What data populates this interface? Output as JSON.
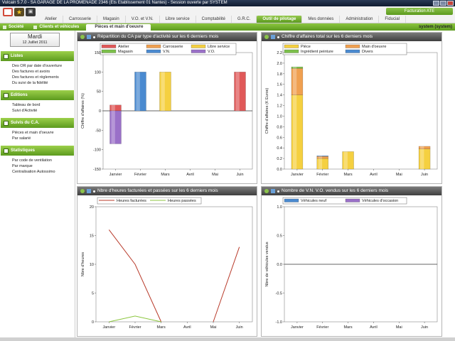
{
  "window": {
    "title": "Vulcain 5.7.0 - SA GARAGE DE LA PROMENADE 2346 (Ets Etablissement 01 Nantes) - Session ouverte par SYSTEM"
  },
  "toolbar": {
    "facturation_label": "Facturation ATE"
  },
  "menu": {
    "tabs": [
      {
        "label": "Atelier",
        "active": false
      },
      {
        "label": "Carrosserie",
        "active": false
      },
      {
        "label": "Magasin",
        "active": false
      },
      {
        "label": "V.O. et V.N.",
        "active": false
      },
      {
        "label": "Libre service",
        "active": false
      },
      {
        "label": "Comptabilité",
        "active": false
      },
      {
        "label": "G.R.C.",
        "active": false
      },
      {
        "label": "Outil de pilotage",
        "active": true
      },
      {
        "label": "Mes données",
        "active": false
      },
      {
        "label": "Administration",
        "active": false
      },
      {
        "label": "Fiducial",
        "active": false
      }
    ]
  },
  "submenu": {
    "items": [
      {
        "label": "Société",
        "selected": false
      },
      {
        "label": "Clients et véhicules",
        "selected": false
      },
      {
        "label": "Pièces et main d'oeuvre",
        "selected": true
      }
    ],
    "user": "system (system)"
  },
  "sidebar": {
    "day": "Mardi",
    "date": "12 Juillet 2011",
    "sections": [
      {
        "title": "Listes",
        "links": [
          "Des OR par date d'ouverture",
          "Des factures et avoirs",
          "Des factures et règlements",
          "Du suivi de la fidélité"
        ]
      },
      {
        "title": "Editions",
        "links": [
          "Tableau de bord",
          "Suivi d'Activité"
        ]
      },
      {
        "title": "Suivis du C.A.",
        "links": [
          "Pièces et main d'oeuvre",
          "Par salarié"
        ]
      },
      {
        "title": "Statistiques",
        "links": [
          "Par code de ventilation",
          "Par marque",
          "Centralisation Autossimo"
        ]
      }
    ]
  },
  "panels": {
    "p1": {
      "title": "Répartition du CA par type d'activité sur les 6 derniers mois"
    },
    "p2": {
      "title": "Chiffre d'affaires total sur les 6 derniers mois"
    },
    "p3": {
      "title": "Nbre d'heures facturées et passées sur les 6 derniers mois"
    },
    "p4": {
      "title": "Nombre de V.N.   V.O.   vendus sur les 6 derniers mois"
    }
  },
  "chart_data": [
    {
      "type": "bar",
      "categories": [
        "Janvier",
        "Février",
        "Mars",
        "Avril",
        "Mai",
        "Juin"
      ],
      "ylabel": "Chiffre d'affaires (%)",
      "ylim": [
        -150,
        150
      ],
      "yticks": [
        -150,
        -100,
        -50,
        0,
        50,
        100,
        150
      ],
      "legend": "top",
      "series": [
        {
          "name": "Atelier",
          "color": "#e05858",
          "values": [
            15,
            0,
            0,
            0,
            0,
            100
          ]
        },
        {
          "name": "Carrosserie",
          "color": "#f0a050",
          "values": [
            0,
            0,
            0,
            0,
            0,
            0
          ]
        },
        {
          "name": "Libre service",
          "color": "#f5d040",
          "values": [
            0,
            0,
            100,
            0,
            0,
            0
          ]
        },
        {
          "name": "Magasin",
          "color": "#7cc04a",
          "values": [
            0,
            0,
            0,
            0,
            0,
            0
          ]
        },
        {
          "name": "V.N.",
          "color": "#4a8ad0",
          "values": [
            0,
            100,
            0,
            0,
            0,
            0
          ]
        },
        {
          "name": "V.O.",
          "color": "#9a70c8",
          "values": [
            -85,
            0,
            0,
            0,
            0,
            0
          ]
        }
      ]
    },
    {
      "type": "bar",
      "stacked": true,
      "categories": [
        "Janvier",
        "Février",
        "Mars",
        "Avril",
        "Mai",
        "Juin"
      ],
      "ylabel": "Chiffre d'affaires (K Euros)",
      "ylim": [
        0,
        2.2
      ],
      "yticks": [
        0.0,
        0.2,
        0.4,
        0.6,
        0.8,
        1.0,
        1.2,
        1.4,
        1.6,
        1.8,
        2.0,
        2.2
      ],
      "legend": "top",
      "series": [
        {
          "name": "Pièce",
          "color": "#f5d040",
          "values": [
            1.4,
            0.2,
            0.33,
            0,
            0,
            0.38
          ]
        },
        {
          "name": "Main d'oeuvre",
          "color": "#f0a050",
          "values": [
            0.5,
            0.04,
            0,
            0,
            0,
            0.05
          ]
        },
        {
          "name": "Ingrédient peinture",
          "color": "#7cc04a",
          "values": [
            0.03,
            0,
            0,
            0,
            0,
            0
          ]
        },
        {
          "name": "Divers",
          "color": "#4a8ad0",
          "values": [
            0,
            0.01,
            0,
            0,
            0,
            0
          ]
        }
      ]
    },
    {
      "type": "line",
      "categories": [
        "Janvier",
        "Février",
        "Mars",
        "Avril",
        "Mai",
        "Juin"
      ],
      "ylabel": "Nbre d'heures",
      "ylim": [
        0,
        20
      ],
      "yticks": [
        0,
        5,
        10,
        15,
        20
      ],
      "legend": "top",
      "series": [
        {
          "name": "Heures facturées",
          "color": "#b83a2a",
          "values": [
            16,
            10,
            0,
            null,
            0,
            13
          ]
        },
        {
          "name": "Heures passées",
          "color": "#8cc63f",
          "values": [
            0,
            1,
            0,
            null,
            null,
            null
          ]
        }
      ]
    },
    {
      "type": "bar",
      "categories": [
        "Janvier",
        "Février",
        "Mars",
        "Avril",
        "Mai",
        "Juin"
      ],
      "ylabel": "Nbre de véhicules vendus",
      "ylim": [
        -1.0,
        1.0
      ],
      "yticks": [
        -1.0,
        -0.5,
        0.0,
        0.5,
        1.0
      ],
      "legend": "top",
      "series": [
        {
          "name": "Véhicules neuf",
          "color": "#4a8ad0",
          "values": [
            0,
            0,
            0,
            0,
            0,
            0
          ]
        },
        {
          "name": "Véhicules d'occasion",
          "color": "#9a70c8",
          "values": [
            0,
            0,
            0,
            0,
            0,
            0
          ]
        }
      ]
    }
  ]
}
